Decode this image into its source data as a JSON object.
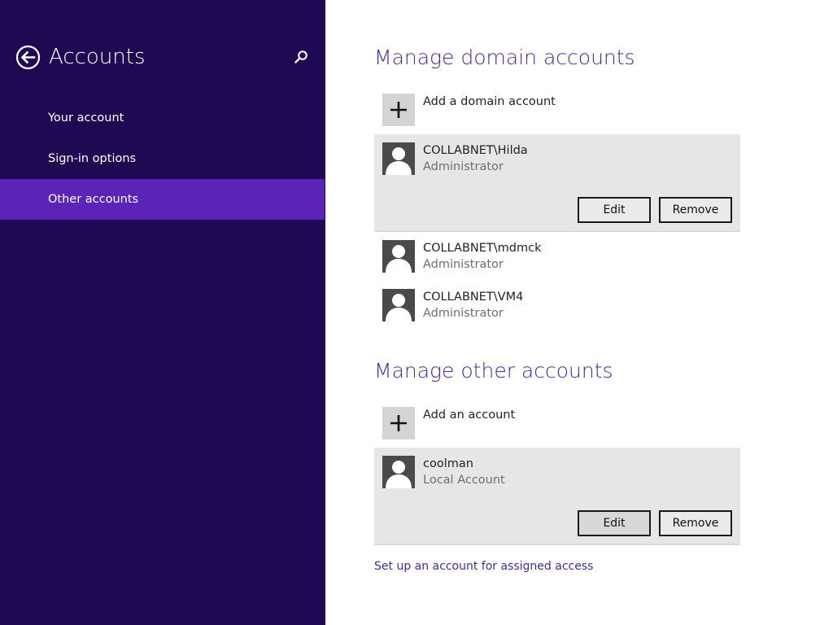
{
  "sidebar": {
    "title": "Accounts",
    "back_icon": "back-arrow-icon",
    "search_icon": "search-icon",
    "items": [
      {
        "label": "Your account",
        "selected": false
      },
      {
        "label": "Sign-in options",
        "selected": false
      },
      {
        "label": "Other accounts",
        "selected": true
      }
    ]
  },
  "domain_section": {
    "title": "Manage domain accounts",
    "add_label": "Add a domain account",
    "accounts": [
      {
        "name": "COLLABNET\\Hilda",
        "type": "Administrator",
        "expanded": true,
        "edit_label": "Edit",
        "remove_label": "Remove"
      },
      {
        "name": "COLLABNET\\mdmck",
        "type": "Administrator",
        "expanded": false
      },
      {
        "name": "COLLABNET\\VM4",
        "type": "Administrator",
        "expanded": false
      }
    ]
  },
  "other_section": {
    "title": "Manage other accounts",
    "add_label": "Add an account",
    "accounts": [
      {
        "name": "coolman",
        "type": "Local Account",
        "expanded": true,
        "edit_label": "Edit",
        "remove_label": "Remove"
      }
    ]
  },
  "assigned_access_link": "Set up an account for assigned access",
  "colors": {
    "sidebar_bg": "#1e0a52",
    "selected_item": "#5b23b6",
    "accent_text": "#4a2a9a",
    "expanded_row": "#e6e6e6"
  }
}
